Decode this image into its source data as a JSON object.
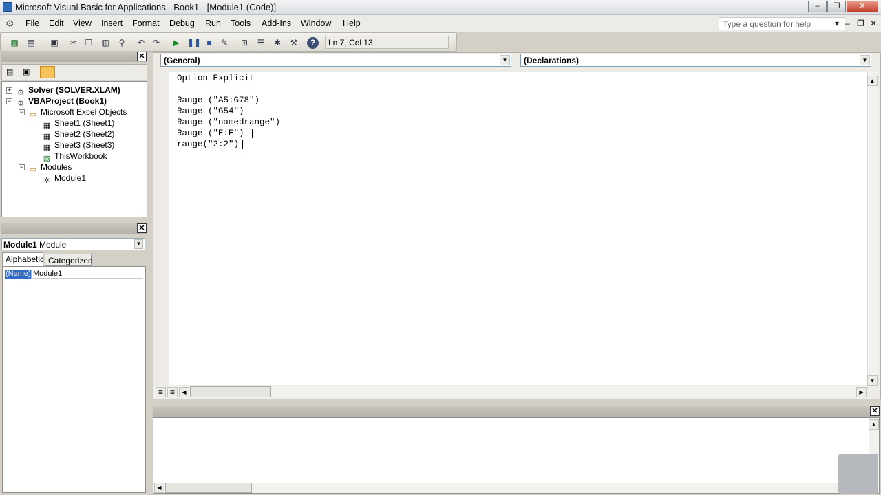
{
  "window": {
    "title": "Microsoft Visual Basic for Applications - Book1 - [Module1 (Code)]",
    "min": "–",
    "restore": "❐",
    "close": "✕"
  },
  "menu": {
    "items": [
      "File",
      "Edit",
      "View",
      "Insert",
      "Format",
      "Debug",
      "Run",
      "Tools",
      "Add-Ins",
      "Window",
      "Help"
    ],
    "help_placeholder": "Type a question for help"
  },
  "toolbar": {
    "position": "Ln 7, Col 13"
  },
  "project_explorer": {
    "tree": [
      {
        "label": "Solver (SOLVER.XLAM)",
        "bold": true
      },
      {
        "label": "VBAProject (Book1)",
        "bold": true
      },
      {
        "label": "Microsoft Excel Objects",
        "bold": false
      },
      {
        "label": "Sheet1 (Sheet1)",
        "bold": false
      },
      {
        "label": "Sheet2 (Sheet2)",
        "bold": false
      },
      {
        "label": "Sheet3 (Sheet3)",
        "bold": false
      },
      {
        "label": "ThisWorkbook",
        "bold": false
      },
      {
        "label": "Modules",
        "bold": false
      },
      {
        "label": "Module1",
        "bold": false
      }
    ]
  },
  "properties": {
    "object_name": "Module1",
    "object_type": "Module",
    "tabs": [
      "Alphabetic",
      "Categorized"
    ],
    "rows": [
      {
        "name": "(Name)",
        "value": "Module1"
      }
    ]
  },
  "code_window": {
    "object_combo": "(General)",
    "procedure_combo": "(Declarations)",
    "lines": [
      "Option Explicit",
      "",
      "Range (\"A5:G78\")",
      "Range (\"G54\")",
      "Range (\"namedrange\")",
      "Range (\"E:E\")",
      "range(\"2:2\")"
    ]
  }
}
